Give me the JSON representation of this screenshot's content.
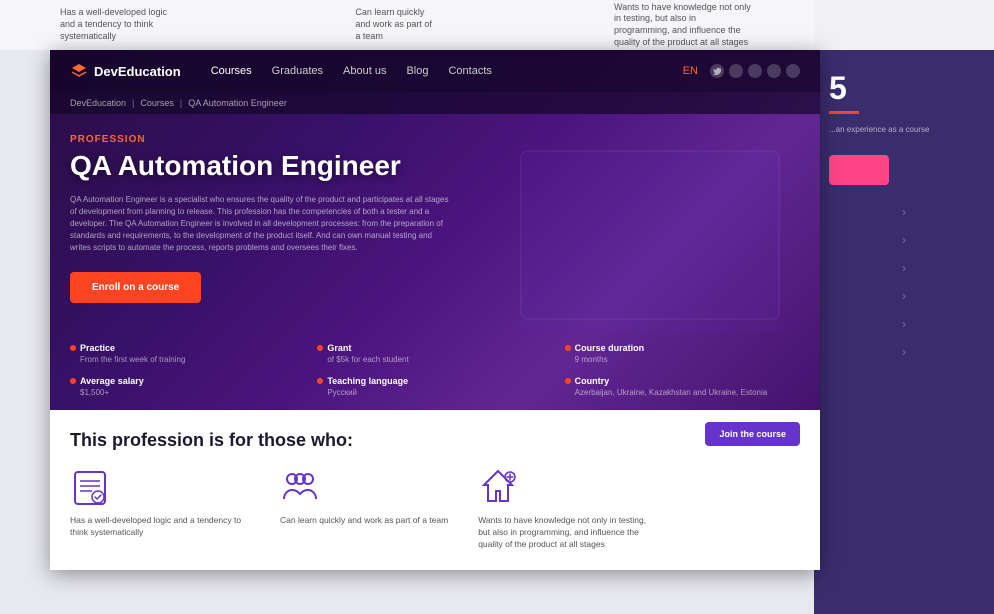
{
  "meta": {
    "title": "QA Automation Engineer - DevEducation",
    "dimensions": "994x614"
  },
  "top_strip": {
    "cards": [
      {
        "text": "Has a well-developed logic and a tendency to think systematically"
      },
      {
        "text": "Can learn quickly and work as part of a team"
      },
      {
        "text": "Wants to have knowledge not only in testing, but also in programming, and influence the quality of the product at all stages"
      }
    ]
  },
  "nav": {
    "logo": "DevEducation",
    "logo_icon": "graduation-cap",
    "links": [
      "Courses",
      "Graduates",
      "About us",
      "Blog",
      "Contacts"
    ],
    "lang": "EN",
    "social_icons": [
      "twitter",
      "instagram",
      "linkedin",
      "youtube",
      "facebook"
    ]
  },
  "breadcrumb": {
    "items": [
      "DevEducation",
      "Courses",
      "QA Automation Engineer"
    ],
    "separator": "|"
  },
  "hero": {
    "profession_label": "Profession",
    "title": "QA Automation Engineer",
    "description": "QA Automation Engineer is a specialist who ensures the quality of the product and participates at all stages of development from planning to release. This profession has the competencies of both a tester and a developer. The QA Automation Engineer is involved in all development processes: from the preparation of standards and requirements, to the development of the product itself. And can own manual testing and writes scripts to automate the process, reports problems and oversees their fixes.",
    "enroll_button": "Enroll on a course"
  },
  "stats": [
    {
      "label": "Practice",
      "value": "From the first week of training"
    },
    {
      "label": "Grant",
      "value": "of $5k for each student"
    },
    {
      "label": "Course duration",
      "value": "9 months"
    },
    {
      "label": "Average salary",
      "value": "$1,500+"
    },
    {
      "label": "Teaching language",
      "value": "Русский"
    },
    {
      "label": "Country",
      "value": "Azerbaijan, Ukraine, Kazakhstan and Ukraine, Estonia"
    }
  ],
  "bottom_section": {
    "join_button": "Join the course",
    "section_title": "This profession is for those who:",
    "features": [
      {
        "icon": "clipboard-list",
        "text": "Has a well-developed logic and a tendency to think systematically"
      },
      {
        "icon": "team-work",
        "text": "Can learn quickly and work as part of a team"
      },
      {
        "icon": "mountain-flag",
        "text": "Wants to have knowledge not only in testing, but also in programming, and influence the quality of the product at all stages"
      }
    ]
  },
  "right_panel": {
    "number": "5",
    "description": "...an experience as a course",
    "arrows": [
      "›",
      "›",
      "›",
      "›",
      "›",
      "›"
    ]
  },
  "colors": {
    "brand_purple": "#6633cc",
    "brand_red": "#ff4422",
    "profession_orange": "#ff6633",
    "nav_bg": "rgba(20,5,40,0.85)",
    "hero_bg_start": "#1a0a2e",
    "hero_bg_end": "#6b2fa0",
    "right_panel_bg": "#3a2d6e",
    "white": "#ffffff"
  }
}
